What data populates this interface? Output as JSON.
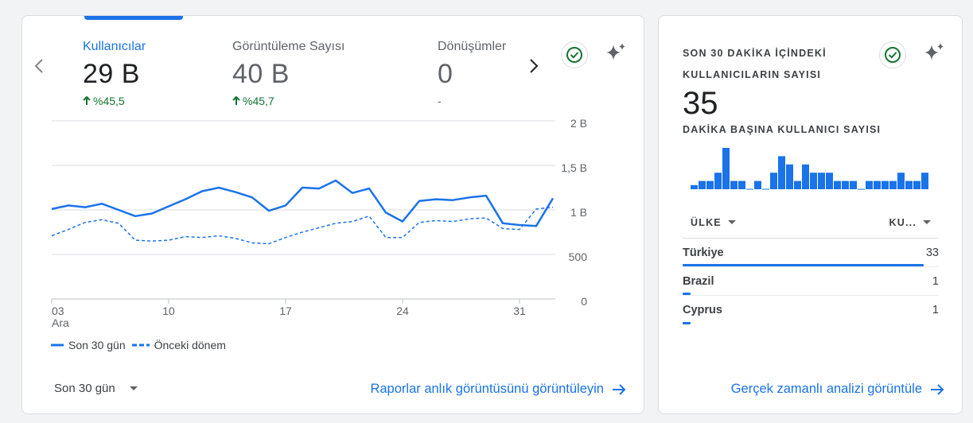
{
  "left_card": {
    "metrics": [
      {
        "label": "Kullanıcılar",
        "value": "29 B",
        "change": "%45,5",
        "active": true
      },
      {
        "label": "Görüntüleme Sayısı",
        "value": "40 B",
        "change": "%45,7",
        "active": false
      },
      {
        "label": "Dönüşümler",
        "value": "0",
        "change": "-",
        "active": false
      }
    ],
    "legend": {
      "current": "Son 30 gün",
      "previous": "Önceki dönem"
    },
    "date_range": "Son 30 gün",
    "link": "Raporlar anlık görüntüsünü görüntüleyin"
  },
  "right_card": {
    "title": "SON 30 DAKİKA İÇİNDEKİ KULLANICILARIN SAYISI",
    "count": "35",
    "subtitle": "DAKİKA BAŞINA KULLANICI SAYISI",
    "per_minute": [
      1,
      2,
      2,
      4,
      10,
      2,
      2,
      0,
      2,
      0,
      4,
      8,
      6,
      2,
      6,
      4,
      4,
      4,
      2,
      2,
      2,
      0,
      2,
      2,
      2,
      2,
      4,
      2,
      2,
      4,
      1,
      1
    ],
    "table": {
      "col_country": "ÜLKE",
      "col_users": "KU...",
      "rows": [
        {
          "country": "Türkiye",
          "value": "33",
          "share": 0.94
        },
        {
          "country": "Brazil",
          "value": "1",
          "share": 0.03
        },
        {
          "country": "Cyprus",
          "value": "1",
          "share": 0.03
        }
      ]
    },
    "link": "Gerçek zamanlı analizi görüntüle"
  },
  "colors": {
    "accent": "#1a73e8",
    "positive": "#137333",
    "grid": "#dadce0"
  },
  "chart_data": {
    "type": "line",
    "x": [
      "03 Ara",
      "04",
      "05",
      "06",
      "07",
      "08",
      "09",
      "10",
      "11",
      "12",
      "13",
      "14",
      "15",
      "16",
      "17",
      "18",
      "19",
      "20",
      "21",
      "22",
      "23",
      "24",
      "25",
      "26",
      "27",
      "28",
      "29",
      "30",
      "31",
      "01",
      "02"
    ],
    "x_tick_labels": [
      "03",
      "10",
      "17",
      "24",
      "31"
    ],
    "x_tick_sublabel": "Ara",
    "y_tick_labels": [
      "2 B",
      "1,5 B",
      "1 B",
      "500",
      "0"
    ],
    "ylim": [
      0,
      2000
    ],
    "series": [
      {
        "name": "Son 30 gün",
        "style": "solid",
        "values": [
          1010,
          1050,
          1030,
          1070,
          1000,
          930,
          960,
          1040,
          1120,
          1210,
          1250,
          1200,
          1140,
          990,
          1050,
          1250,
          1240,
          1330,
          1190,
          1240,
          970,
          870,
          1100,
          1120,
          1110,
          1140,
          1160,
          850,
          830,
          820,
          1130
        ]
      },
      {
        "name": "Önceki dönem",
        "style": "dashed",
        "values": [
          710,
          780,
          860,
          890,
          850,
          660,
          650,
          660,
          700,
          690,
          710,
          680,
          630,
          620,
          690,
          750,
          800,
          850,
          870,
          930,
          690,
          690,
          860,
          880,
          870,
          900,
          910,
          790,
          780,
          1010,
          1030
        ]
      }
    ]
  }
}
